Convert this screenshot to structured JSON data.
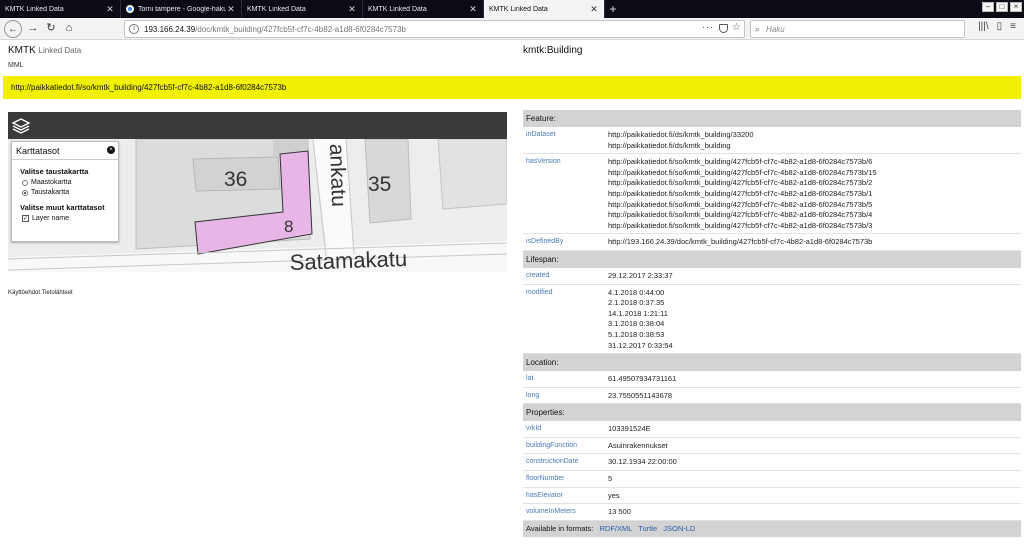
{
  "browser": {
    "tabs": [
      {
        "label": "KMTK Linked Data",
        "active": false,
        "has_favicon": false
      },
      {
        "label": "Torni tampere - Google-haku",
        "active": false,
        "has_favicon": true
      },
      {
        "label": "KMTK Linked Data",
        "active": false,
        "has_favicon": false
      },
      {
        "label": "KMTK Linked Data",
        "active": false,
        "has_favicon": false
      },
      {
        "label": "KMTK Linked Data",
        "active": true,
        "has_favicon": false
      }
    ],
    "url_host": "193.166.24.39",
    "url_path": "/doc/kmtk_building/427fcb5f-cf7c-4b82-a1d8-6f0284c7573b",
    "search_placeholder": "Haku",
    "tab_close_glyph": "✕",
    "new_tab_glyph": "+"
  },
  "header": {
    "brand": "KMTK",
    "brand_sub": "Linked Data",
    "org": "MML",
    "type_title": "kmtk:Building",
    "uri": "http://paikkatiedot.fi/so/kmtk_building/427fcb5f-cf7c-4b82-a1d8-6f0284c7573b"
  },
  "map": {
    "panel_title": "Karttatasot",
    "background_heading": "Valitse taustakartta",
    "options": [
      {
        "label": "Maastokartta",
        "selected": false
      },
      {
        "label": "Taustakartta",
        "selected": true
      }
    ],
    "other_heading": "Valitse muut karttatasot",
    "layer_label": "Layer name",
    "layer_checked": true,
    "labels": {
      "block_36": "36",
      "block_35": "35",
      "building_number": "8",
      "street_main": "Satamakatu",
      "street_vertical": "ankatu"
    },
    "attribution": "Käyttöehdot  Tietolähteet"
  },
  "props": {
    "feature": {
      "title": "Feature:",
      "inDataset_label": "inDataset",
      "inDataset": [
        "http://paikkatiedot.fi/ds/kmtk_building/33200",
        "http://paikkatiedot.fi/ds/kmtk_building"
      ],
      "hasVersion_label": "hasVersion",
      "hasVersion": [
        "http://paikkatiedot.fi/so/kmtk_building/427fcb5f-cf7c-4b82-a1d8-6f0284c7573b/6",
        "http://paikkatiedot.fi/so/kmtk_building/427fcb5f-cf7c-4b82-a1d8-6f0284c7573b/15",
        "http://paikkatiedot.fi/so/kmtk_building/427fcb5f-cf7c-4b82-a1d8-6f0284c7573b/2",
        "http://paikkatiedot.fi/so/kmtk_building/427fcb5f-cf7c-4b82-a1d8-6f0284c7573b/1",
        "http://paikkatiedot.fi/so/kmtk_building/427fcb5f-cf7c-4b82-a1d8-6f0284c7573b/5",
        "http://paikkatiedot.fi/so/kmtk_building/427fcb5f-cf7c-4b82-a1d8-6f0284c7573b/4",
        "http://paikkatiedot.fi/so/kmtk_building/427fcb5f-cf7c-4b82-a1d8-6f0284c7573b/3"
      ],
      "isDefinedBy_label": "isDefinedBy",
      "isDefinedBy": "http://193.166.24.39/doc/kmtk_building/427fcb5f-cf7c-4b82-a1d8-6f0284c7573b"
    },
    "lifespan": {
      "title": "Lifespan:",
      "created_label": "created",
      "created": "29.12.2017 2:33:37",
      "modified_label": "modified",
      "modified": [
        "4.1.2018 0:44:00",
        "2.1.2018 0:37:35",
        "14.1.2018 1:21:11",
        "3.1.2018 0:38:04",
        "5.1.2018 0:38:53",
        "31.12.2017 0:33:54"
      ]
    },
    "location": {
      "title": "Location:",
      "lat_label": "lat",
      "lat": "61.49507934731161",
      "long_label": "long",
      "long": "23.7550551143678"
    },
    "properties": {
      "title": "Properties:",
      "rows": [
        {
          "key": "vrkId",
          "value": "103391524E"
        },
        {
          "key": "buildingFunction",
          "value": "Asuinrakennukset"
        },
        {
          "key": "constructionDate",
          "value": "30.12.1934 22:00:00"
        },
        {
          "key": "floorNumber",
          "value": "5"
        },
        {
          "key": "hasElevator",
          "value": "yes"
        },
        {
          "key": "volumeInMeters",
          "value": "13 500"
        }
      ]
    },
    "formats_label": "Available in formats:",
    "formats": [
      "RDF/XML",
      "Turtle",
      "JSON-LD"
    ]
  },
  "colors": {
    "uri_bar": "#f0f000",
    "section_bg": "#d3d3d3",
    "key_text": "#4a7ab7",
    "building_fill": "#e8b6e6"
  }
}
